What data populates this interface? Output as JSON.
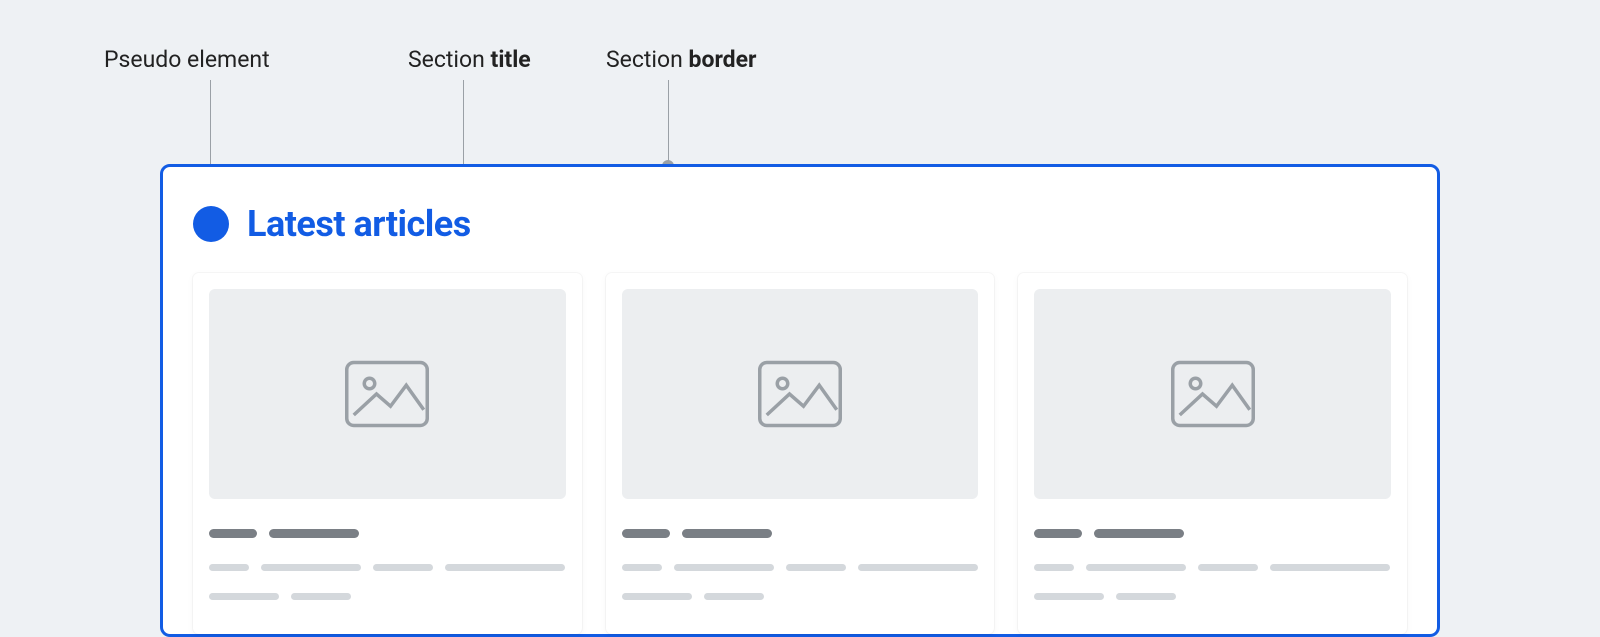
{
  "annotations": {
    "pseudo": "Pseudo element",
    "title_prefix": "Section ",
    "title_bold": "title",
    "border_prefix": "Section ",
    "border_bold": "border"
  },
  "section": {
    "title": "Latest articles"
  },
  "colors": {
    "accent": "#125ce4",
    "bg": "#eef1f4"
  }
}
